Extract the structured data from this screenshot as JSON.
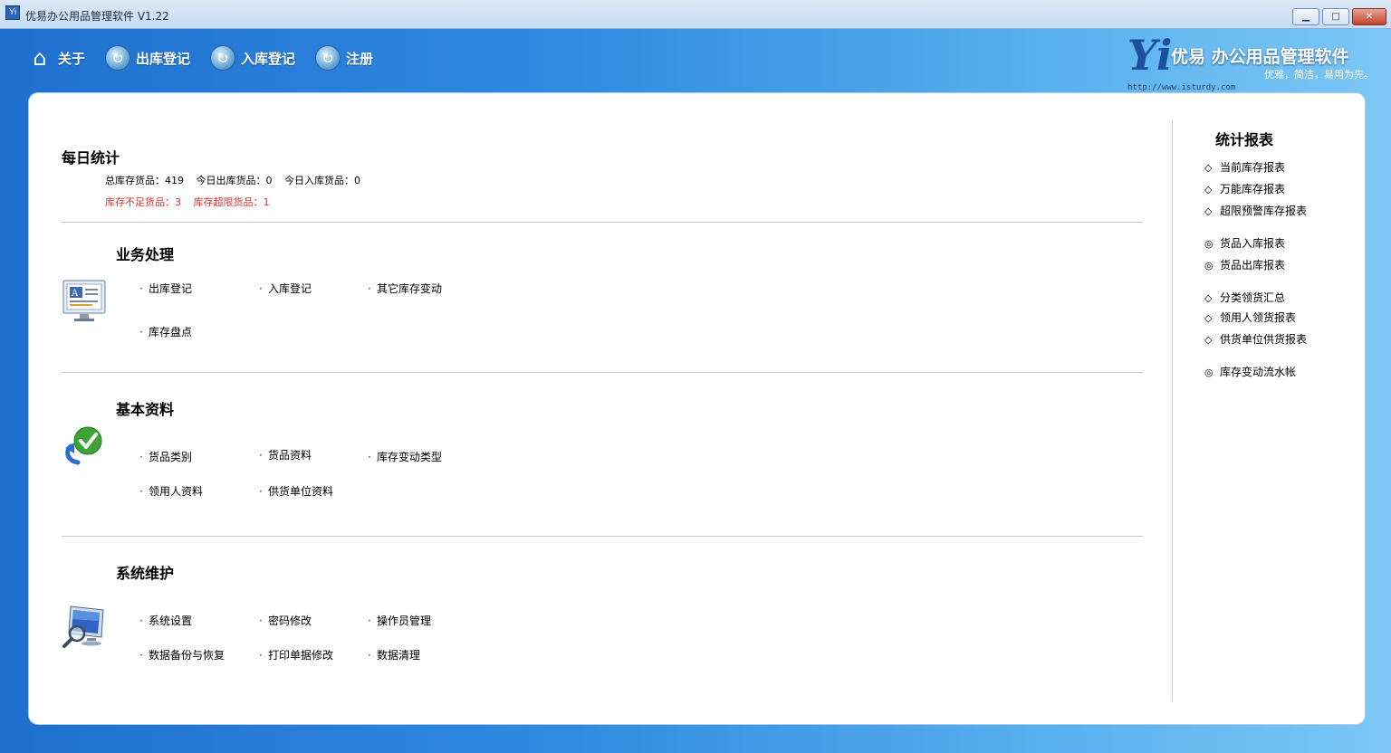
{
  "window": {
    "title": "优易办公用品管理软件 V1.22",
    "min_glyph": "▁",
    "max_glyph": "□",
    "close_glyph": "✕"
  },
  "toolbar": {
    "items": [
      {
        "label": "关于",
        "icon": "home-icon"
      },
      {
        "label": "出库登记",
        "icon": "refresh-icon"
      },
      {
        "label": "入库登记",
        "icon": "refresh-icon"
      },
      {
        "label": "注册",
        "icon": "refresh-icon"
      }
    ]
  },
  "brand": {
    "mark": "Yi",
    "name": "优易 办公用品管理软件",
    "slogan": "优雅，简洁，易用为先。",
    "url": "http://www.isturdy.com"
  },
  "daily": {
    "title": "每日统计",
    "total_stock": "总库存货品：419",
    "today_out": "今日出库货品：0",
    "today_in": "今日入库货品：0",
    "shortage": "库存不足货品：3",
    "overlimit": "库存超限货品：1"
  },
  "business": {
    "title": "业务处理",
    "links": [
      "出库登记",
      "入库登记",
      "其它库存变动",
      "库存盘点"
    ]
  },
  "basic": {
    "title": "基本资料",
    "links": [
      "货品类别",
      "货品资料",
      "库存变动类型",
      "领用人资料",
      "供货单位资料"
    ]
  },
  "system": {
    "title": "系统维护",
    "links": [
      "系统设置",
      "密码修改",
      "操作员管理",
      "数据备份与恢复",
      "打印单据修改",
      "数据清理"
    ]
  },
  "reports": {
    "title": "统计报表",
    "diamond": "◇",
    "circle": "◎",
    "items": [
      "当前库存报表",
      "万能库存报表",
      "超限预警库存报表",
      "货品入库报表",
      "货品出库报表",
      "分类领货汇总",
      "领用人领货报表",
      "供货单位供货报表",
      "库存变动流水帐"
    ]
  },
  "colors": {
    "warning": "#e0302a",
    "header_start": "#1f6fcf",
    "header_end": "#7cc7f5"
  }
}
